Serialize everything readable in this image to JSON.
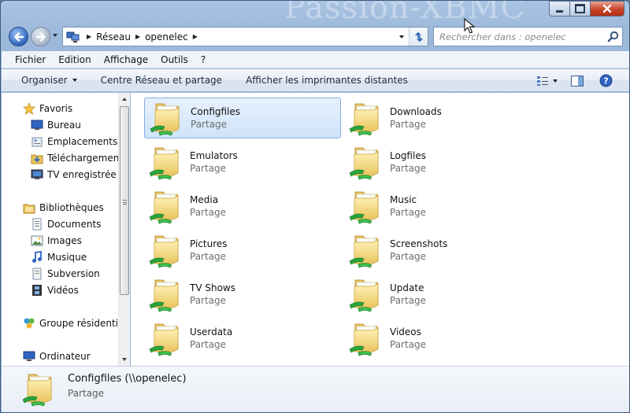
{
  "window": {
    "watermark_text": "Passion-XBMC"
  },
  "nav": {
    "breadcrumb": [
      "Réseau",
      "openelec"
    ],
    "search_placeholder": "Rechercher dans : openelec"
  },
  "menu": [
    "Fichier",
    "Edition",
    "Affichage",
    "Outils",
    "?"
  ],
  "commands": {
    "organiser": "Organiser",
    "network_center": "Centre Réseau et partage",
    "printers": "Afficher les imprimantes distantes"
  },
  "sidebar": {
    "favorites": {
      "label": "Favoris",
      "items": [
        "Bureau",
        "Emplacements récents",
        "Téléchargements",
        "TV enregistrée"
      ]
    },
    "libraries": {
      "label": "Bibliothèques",
      "items": [
        "Documents",
        "Images",
        "Musique",
        "Subversion",
        "Vidéos"
      ]
    },
    "homegroup": "Groupe résidentiel",
    "computer": "Ordinateur"
  },
  "shares": [
    {
      "name": "Configfiles",
      "type": "Partage",
      "selected": true
    },
    {
      "name": "Downloads",
      "type": "Partage"
    },
    {
      "name": "Emulators",
      "type": "Partage"
    },
    {
      "name": "Logfiles",
      "type": "Partage"
    },
    {
      "name": "Media",
      "type": "Partage"
    },
    {
      "name": "Music",
      "type": "Partage"
    },
    {
      "name": "Pictures",
      "type": "Partage"
    },
    {
      "name": "Screenshots",
      "type": "Partage"
    },
    {
      "name": "TV Shows",
      "type": "Partage"
    },
    {
      "name": "Update",
      "type": "Partage"
    },
    {
      "name": "Userdata",
      "type": "Partage"
    },
    {
      "name": "Videos",
      "type": "Partage"
    }
  ],
  "details": {
    "name": "Configfiles (\\\\openelec)",
    "type": "Partage"
  },
  "icons": {
    "folder": "shared-folder-icon",
    "search": "search-icon",
    "refresh": "refresh-icon",
    "help": "help-icon"
  }
}
